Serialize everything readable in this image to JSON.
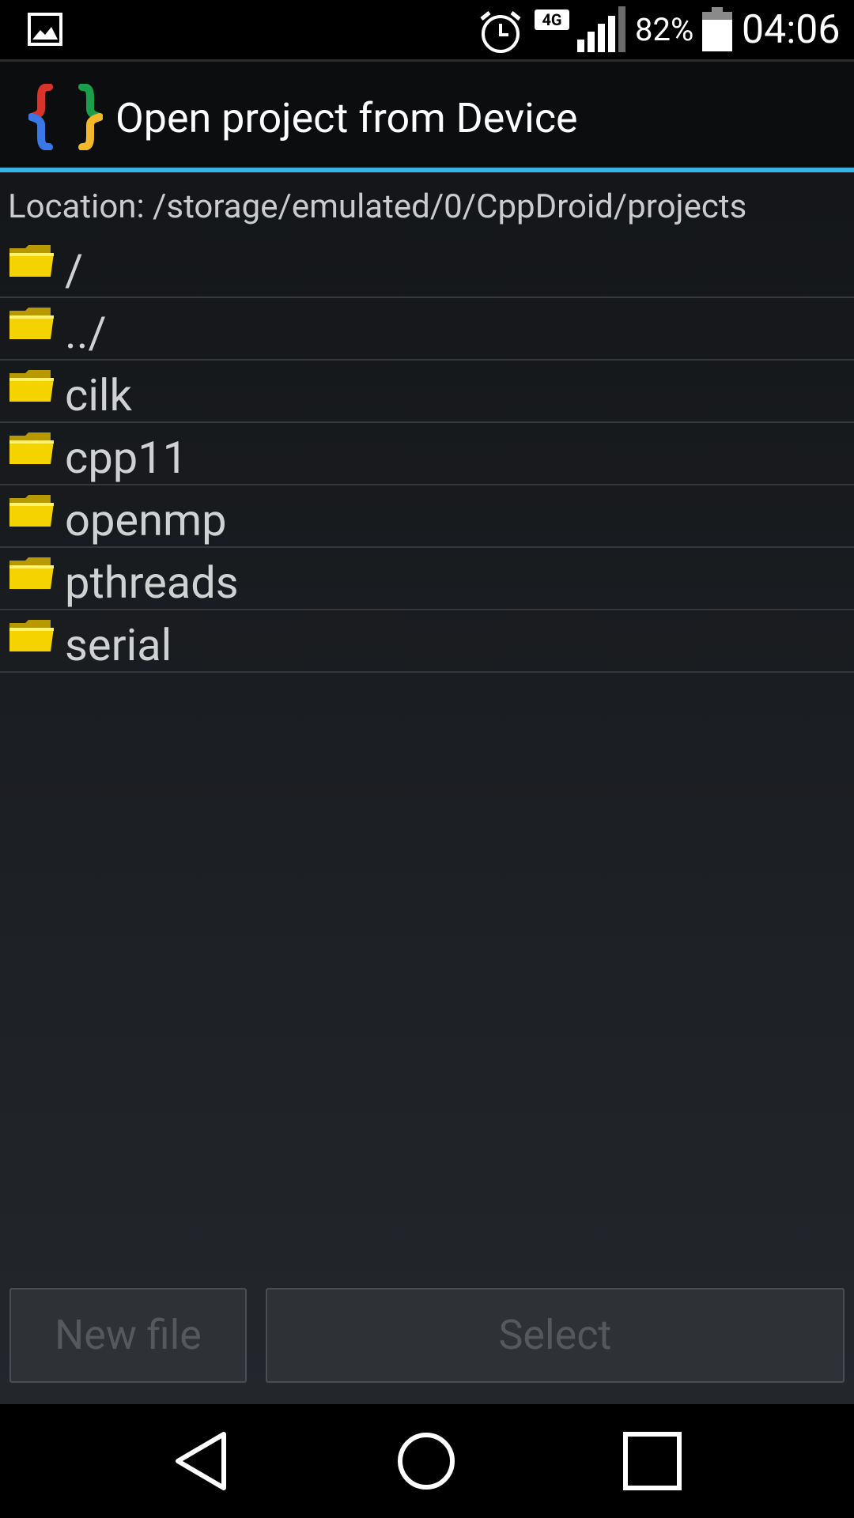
{
  "status_bar": {
    "network": "4G",
    "battery_percent": "82%",
    "time": "04:06",
    "icons": [
      "gallery-icon",
      "alarm-icon",
      "signal-icon",
      "battery-icon"
    ]
  },
  "action_bar": {
    "title": "Open project from Device",
    "logo": "cppdroid-braces-logo"
  },
  "content": {
    "location": "Location: /storage/emulated/0/CppDroid/projects",
    "files": [
      {
        "name": "/"
      },
      {
        "name": "../"
      },
      {
        "name": "cilk"
      },
      {
        "name": "cpp11"
      },
      {
        "name": "openmp"
      },
      {
        "name": "pthreads"
      },
      {
        "name": "serial"
      }
    ]
  },
  "buttons": {
    "new_file": "New file",
    "select": "Select"
  },
  "colors": {
    "accent": "#33b5e5",
    "folder": "#f5d300",
    "background": "#1b1e22"
  }
}
